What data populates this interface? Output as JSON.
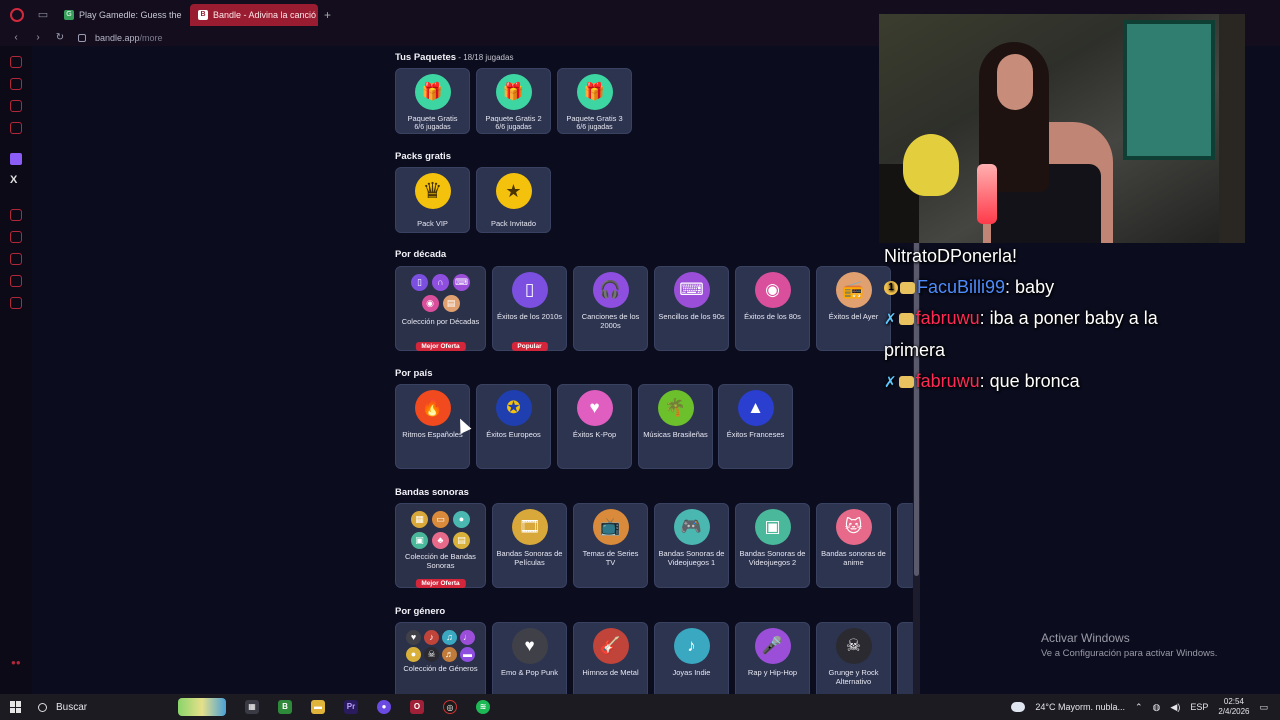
{
  "browser": {
    "tabs": [
      {
        "label": "Play Gamedle: Guess the",
        "favicon": "G",
        "active": false
      },
      {
        "label": "Bandle - Adivina la canció",
        "favicon": "B",
        "active": true
      }
    ],
    "url_host": "bandle.app",
    "url_path": "/more"
  },
  "sections": {
    "paquetes": {
      "title": "Tus Paquetes",
      "subtitle": " - 18/18 jugadas",
      "cards": [
        {
          "label": "Paquete Gratis",
          "sub": "6/6 jugadas",
          "icon": "gift-icon",
          "color": "#3dd6a3",
          "glyph": "🎁"
        },
        {
          "label": "Paquete Gratis 2",
          "sub": "6/6 jugadas",
          "icon": "gift-icon",
          "color": "#3dd6a3",
          "glyph": "🎁"
        },
        {
          "label": "Paquete Gratis 3",
          "sub": "6/6 jugadas",
          "icon": "gift-icon",
          "color": "#3dd6a3",
          "glyph": "🎁"
        }
      ]
    },
    "packs": {
      "title": "Packs gratis",
      "cards": [
        {
          "label": "Pack VIP",
          "icon": "crown-icon",
          "color": "#f4c20d",
          "glyph": "♛"
        },
        {
          "label": "Pack Invitado",
          "icon": "ticket-star-icon",
          "color": "#f4c20d",
          "glyph": "★"
        }
      ]
    },
    "decada": {
      "title": "Por década",
      "collection": {
        "label": "Colección por Décadas",
        "badge": "Mejor Oferta"
      },
      "cards": [
        {
          "label": "Éxitos de los 2010s",
          "icon": "phone-icon",
          "color": "#7b4fe0",
          "glyph": "▯",
          "badge": "Popular"
        },
        {
          "label": "Canciones de los 2000s",
          "icon": "headphones-icon",
          "color": "#8e4fe0",
          "glyph": "🎧",
          "badge": ""
        },
        {
          "label": "Sencillos de los 90s",
          "icon": "gamepad-icon",
          "color": "#9b4fd9",
          "glyph": "⌨",
          "badge": ""
        },
        {
          "label": "Éxitos de los 80s",
          "icon": "vinyl-icon",
          "color": "#d94f9b",
          "glyph": "◉",
          "badge": ""
        },
        {
          "label": "Éxitos del Ayer",
          "icon": "radio-icon",
          "color": "#e0a070",
          "glyph": "📻",
          "badge": ""
        }
      ]
    },
    "pais": {
      "title": "Por país",
      "cards": [
        {
          "label": "Ritmos Españoles",
          "icon": "flame-icon",
          "color": "#f04a1e",
          "glyph": "🔥"
        },
        {
          "label": "Éxitos Europeos",
          "icon": "eu-flag-icon",
          "color": "#1f3fb0",
          "glyph": "✪"
        },
        {
          "label": "Éxitos K-Pop",
          "icon": "heart-hand-icon",
          "color": "#e05ec0",
          "glyph": "♥"
        },
        {
          "label": "Músicas Brasileñas",
          "icon": "palm-tree-icon",
          "color": "#6cc02c",
          "glyph": "🌴"
        },
        {
          "label": "Éxitos Franceses",
          "icon": "eiffel-tower-icon",
          "color": "#2a3ed0",
          "glyph": "▲"
        }
      ]
    },
    "bandas": {
      "title": "Bandas sonoras",
      "collection": {
        "label": "Colección de Bandas Sonoras",
        "badge": "Mejor Oferta"
      },
      "cards": [
        {
          "label": "Bandas Sonoras de Películas",
          "icon": "film-icon",
          "color": "#d9a83a",
          "glyph": "🎞"
        },
        {
          "label": "Temas de Series TV",
          "icon": "tv-icon",
          "color": "#d98a3a",
          "glyph": "📺"
        },
        {
          "label": "Bandas Sonoras de Videojuegos 1",
          "icon": "gamepad-icon",
          "color": "#4ab8b0",
          "glyph": "🎮"
        },
        {
          "label": "Bandas Sonoras de Videojuegos 2",
          "icon": "handheld-icon",
          "color": "#4ab89a",
          "glyph": "▣"
        },
        {
          "label": "Bandas sonoras de anime",
          "icon": "cat-icon",
          "color": "#e86a8a",
          "glyph": "🐱"
        }
      ]
    },
    "genero": {
      "title": "Por género",
      "collection": {
        "label": "Colección de Géneros"
      },
      "cards": [
        {
          "label": "Emo & Pop Punk",
          "icon": "broken-heart-icon",
          "color": "#404048",
          "glyph": "♥"
        },
        {
          "label": "Himnos de Metal",
          "icon": "guitar-icon",
          "color": "#c0443a",
          "glyph": "🎸"
        },
        {
          "label": "Joyas Indie",
          "icon": "acoustic-guitar-icon",
          "color": "#3aa8c0",
          "glyph": "♪"
        },
        {
          "label": "Rap y Hip-Hop",
          "icon": "microphone-icon",
          "color": "#9b4fd9",
          "glyph": "🎤"
        },
        {
          "label": "Grunge y Rock Alternativo",
          "icon": "skull-icon",
          "color": "#2a2a30",
          "glyph": "☠"
        }
      ]
    }
  },
  "chat": [
    {
      "user": "",
      "text": "NitratoDPonerla!",
      "badge": ""
    },
    {
      "user": "FacuBilli99",
      "text": ": baby",
      "badge": "1"
    },
    {
      "user": "fabruwu",
      "text": ": iba a poner baby a la",
      "badge": "sword"
    },
    {
      "user": "",
      "text": "primera",
      "badge": ""
    },
    {
      "user": "fabruwu",
      "text": ": que bronca",
      "badge": "sword"
    }
  ],
  "activate": {
    "title": "Activar Windows",
    "sub": "Ve a Configuración para activar Windows."
  },
  "taskbar": {
    "search": "Buscar",
    "weather": "24°C  Mayorm. nubla...",
    "lang": "ESP",
    "time": "02:54",
    "date": "2/4/2026"
  }
}
